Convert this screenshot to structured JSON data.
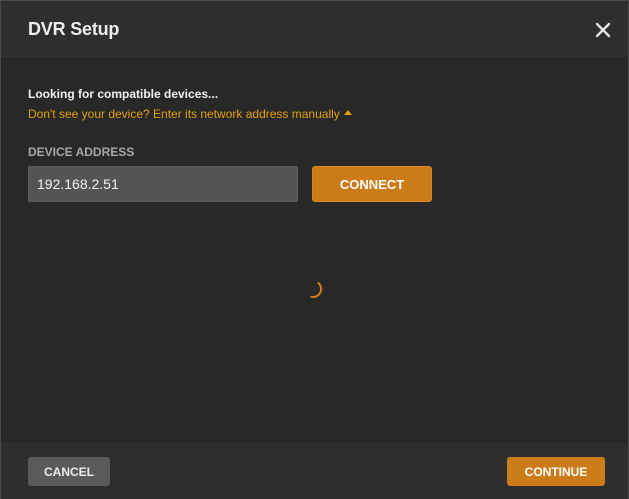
{
  "dialog": {
    "title": "DVR Setup",
    "close_icon": "close-icon"
  },
  "status": {
    "looking_text": "Looking for compatible devices...",
    "manual_link_text": "Don't see your device? Enter its network address manually",
    "manual_link_caret": "caret-up-icon"
  },
  "device_address": {
    "label": "DEVICE ADDRESS",
    "value": "192.168.2.51",
    "connect_label": "CONNECT"
  },
  "loading": {
    "spinner_icon": "loading-spinner-icon"
  },
  "footer": {
    "cancel_label": "CANCEL",
    "continue_label": "CONTINUE"
  },
  "colors": {
    "accent": "#cc7b19",
    "link": "#e5a00d",
    "background": "#282828"
  }
}
